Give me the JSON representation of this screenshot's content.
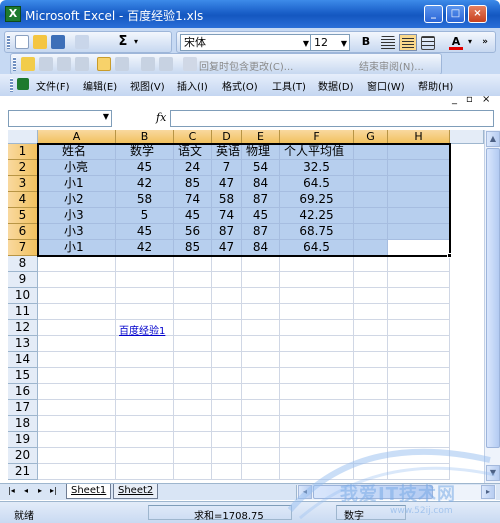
{
  "window": {
    "title": "Microsoft Excel - 百度经验1.xls",
    "icon_label": "X",
    "buttons": {
      "minimize": "_",
      "maximize": "□",
      "close": "×"
    }
  },
  "toolbar": {
    "sum_label": "Σ",
    "font_name": "宋体",
    "font_size": "12",
    "bold_label": "B",
    "font_color_label": "A",
    "review_reply": "回复时包含更改(C)...",
    "review_end": "结束审阅(N)..."
  },
  "menu": {
    "items": [
      "文件(F)",
      "编辑(E)",
      "视图(V)",
      "插入(I)",
      "格式(O)",
      "工具(T)",
      "数据(D)",
      "窗口(W)",
      "帮助(H)"
    ],
    "controls": {
      "minimize": "_",
      "restore": "▫",
      "close": "×"
    }
  },
  "formula": {
    "fx_label": "fx",
    "namebox_value": "",
    "content": ""
  },
  "sheet": {
    "columns": [
      "A",
      "B",
      "C",
      "D",
      "E",
      "F",
      "G",
      "H"
    ],
    "rows": [
      "1",
      "2",
      "3",
      "4",
      "5",
      "6",
      "7",
      "8",
      "9",
      "10",
      "11",
      "12",
      "13",
      "14",
      "15",
      "16",
      "17",
      "18",
      "19",
      "20",
      "21"
    ],
    "headers": [
      "姓名",
      "数学",
      "语文",
      "英语",
      "物理",
      "个人平均值"
    ],
    "data": [
      [
        "小亮",
        "45",
        "24",
        "7",
        "54",
        "32.5"
      ],
      [
        "小1",
        "42",
        "85",
        "47",
        "84",
        "64.5"
      ],
      [
        "小2",
        "58",
        "74",
        "58",
        "87",
        "69.25"
      ],
      [
        "小3",
        "5",
        "45",
        "74",
        "45",
        "42.25"
      ],
      [
        "小3",
        "45",
        "56",
        "87",
        "87",
        "68.75"
      ],
      [
        "小1",
        "42",
        "85",
        "47",
        "84",
        "64.5"
      ]
    ],
    "hyperlink": "百度经验1"
  },
  "tabs": {
    "nav": [
      "|◂",
      "◂",
      "▸",
      "▸|"
    ],
    "sheets": [
      "Sheet1",
      "Sheet2"
    ]
  },
  "status": {
    "ready": "就绪",
    "sum": "求和=1708.75",
    "mode": "数字"
  },
  "watermark": {
    "text": "我爱IT技术网",
    "url": "www.52ij.com"
  },
  "colors": {
    "selection": "#b7cfee",
    "header_highlight": "#f1c15f",
    "titlebar": "#1a5fc8"
  }
}
